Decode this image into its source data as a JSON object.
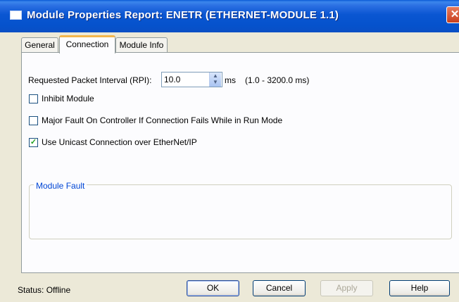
{
  "window": {
    "title": "Module Properties Report: ENETR (ETHERNET-MODULE 1.1)",
    "close_glyph": "✕"
  },
  "tabs": [
    {
      "label": "General",
      "active": false
    },
    {
      "label": "Connection",
      "active": true
    },
    {
      "label": "Module Info",
      "active": false
    }
  ],
  "connection": {
    "rpi_label": "Requested Packet Interval (RPI):",
    "rpi_value": "10.0",
    "rpi_unit": "ms",
    "rpi_range": "(1.0 - 3200.0 ms)",
    "inhibit_label": "Inhibit Module",
    "inhibit_checked": false,
    "major_fault_label": "Major Fault On Controller If Connection Fails While in Run Mode",
    "major_fault_checked": false,
    "unicast_label": "Use Unicast Connection over EtherNet/IP",
    "unicast_checked": true,
    "unicast_check_glyph": "✓",
    "module_fault_title": "Module Fault"
  },
  "footer": {
    "status": "Status:  Offline",
    "ok_label": "OK",
    "cancel_label": "Cancel",
    "apply_label": "Apply",
    "help_label": "Help"
  },
  "colors": {
    "titlebar": "#0a56d2",
    "active_tab_accent": "#f2b64c",
    "group_title": "#0046d5",
    "check": "#21a121"
  }
}
